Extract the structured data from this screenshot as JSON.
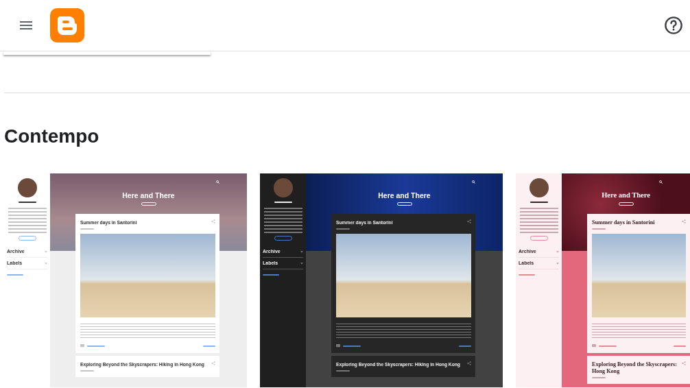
{
  "section": {
    "title": "Contempo"
  },
  "themes": [
    {
      "kind": "light",
      "blog_title": "Here and There",
      "sidebar_items": [
        "Archive",
        "Labels"
      ],
      "posts": [
        {
          "title_lines": [
            "Summer days in Santorini"
          ]
        },
        {
          "title_lines": [
            "Exploring Beyond the Skyscrapers: Hiking in Hong Kong"
          ]
        }
      ]
    },
    {
      "kind": "dark",
      "blog_title": "Here and There",
      "sidebar_items": [
        "Archive",
        "Labels"
      ],
      "posts": [
        {
          "title_lines": [
            "Summer days in Santorini"
          ]
        },
        {
          "title_lines": [
            "Exploring Beyond the Skyscrapers: Hiking in Hong Kong"
          ]
        }
      ]
    },
    {
      "kind": "pink",
      "blog_title": "Here and There",
      "sidebar_items": [
        "Archive",
        "Labels"
      ],
      "posts": [
        {
          "title_lines": [
            "Summer days in Santorini"
          ]
        },
        {
          "title_lines": [
            "Exploring Beyond the Skyscrapers:",
            "Hong Kong"
          ]
        }
      ]
    }
  ]
}
